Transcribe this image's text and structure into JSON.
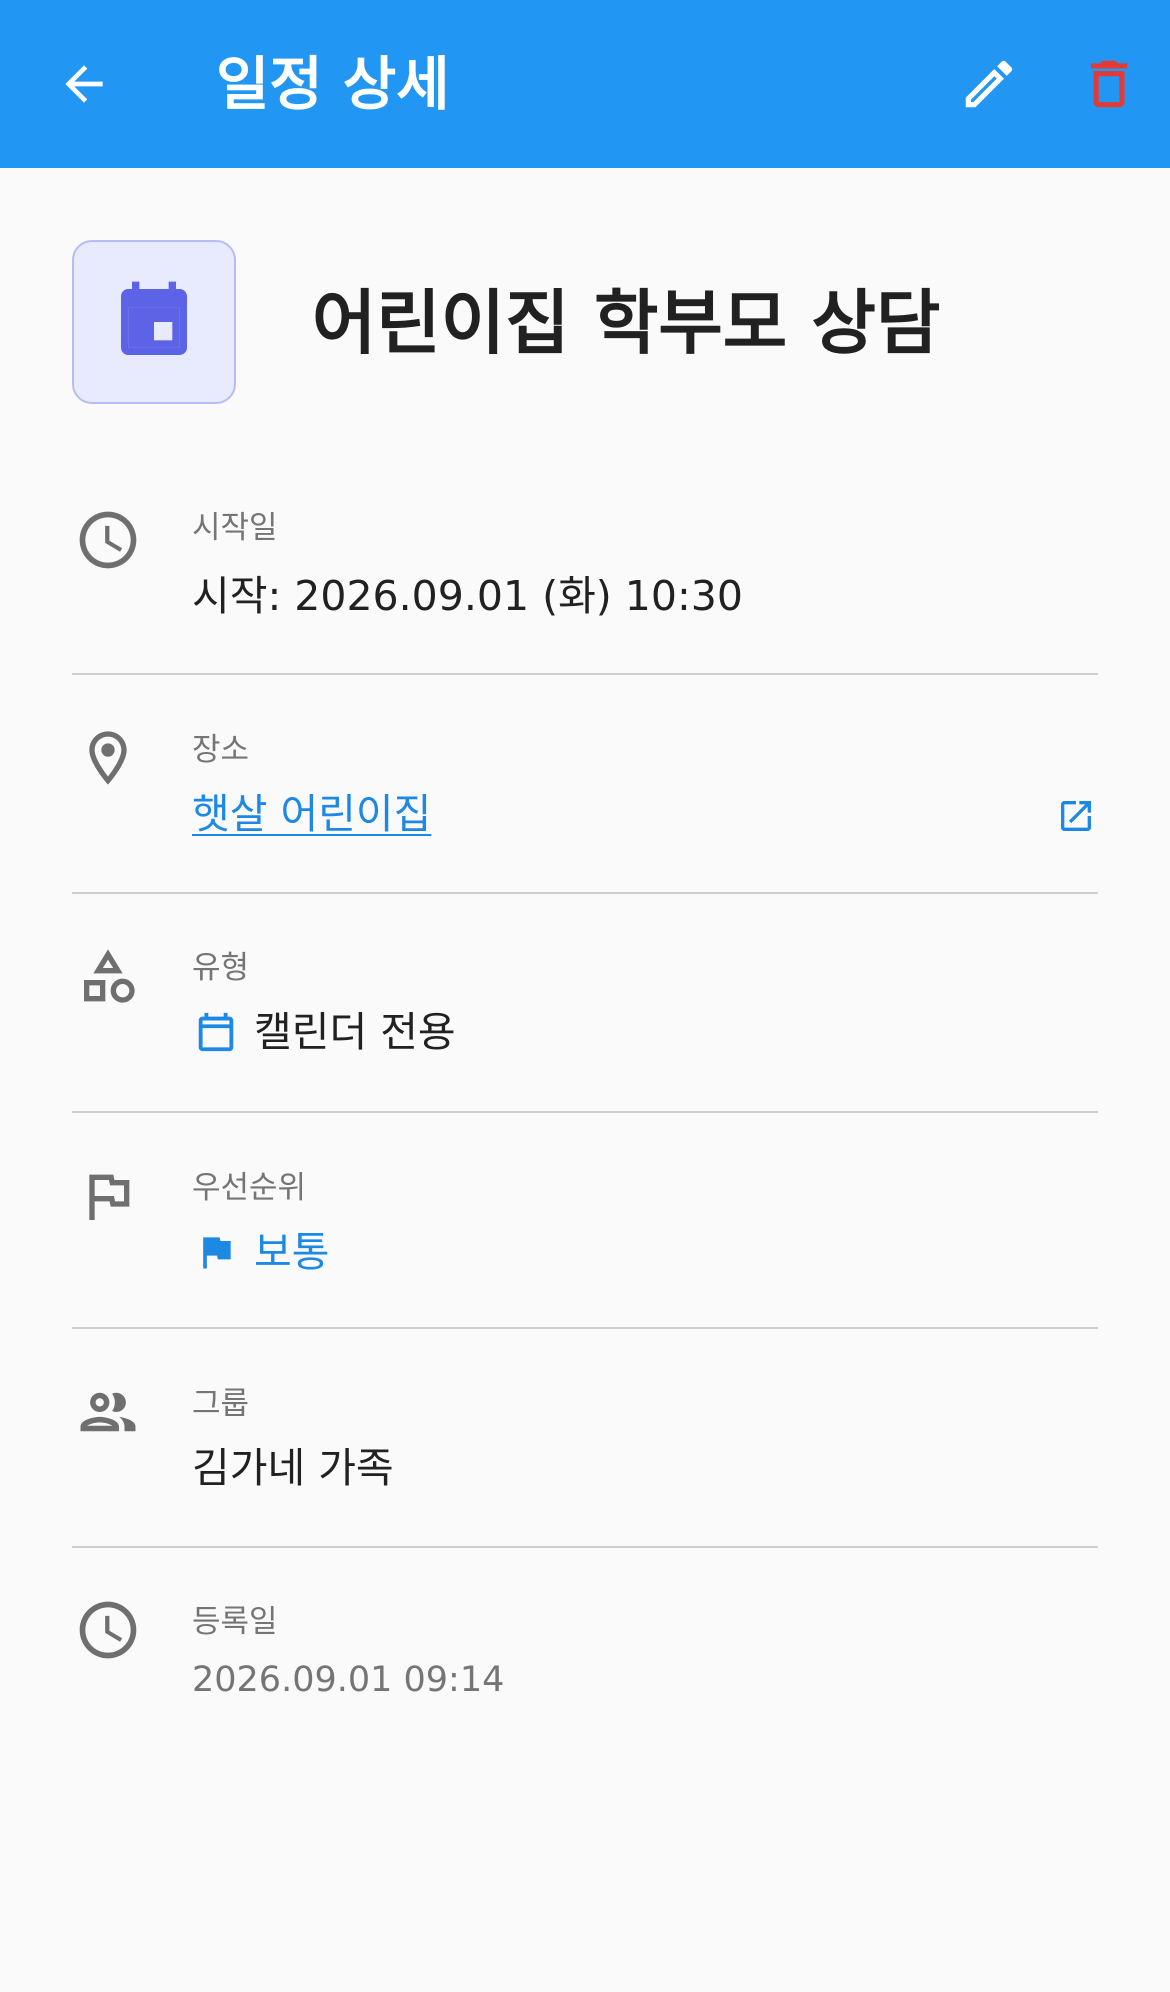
{
  "appbar": {
    "title": "일정 상세",
    "back_icon": "arrow-back-icon",
    "edit_icon": "pencil-icon",
    "delete_icon": "trash-icon"
  },
  "event": {
    "title": "어린이집 학부모 상담",
    "icon": "calendar-icon"
  },
  "details": {
    "start": {
      "label": "시작일",
      "value": "시작: 2026.09.01 (화) 10:30",
      "icon": "clock-icon"
    },
    "location": {
      "label": "장소",
      "value": "햇살 어린이집",
      "icon": "location-pin-icon",
      "action_icon": "open-in-new-icon"
    },
    "type": {
      "label": "유형",
      "value": "캘린더 전용",
      "icon": "category-icon",
      "value_icon": "calendar-icon"
    },
    "priority": {
      "label": "우선순위",
      "value": "보통",
      "icon": "flag-outline-icon",
      "value_icon": "flag-icon"
    },
    "group": {
      "label": "그룹",
      "value": "김가네 가족",
      "icon": "people-icon"
    },
    "registered": {
      "label": "등록일",
      "value": "2026.09.01 09:14",
      "icon": "clock-icon"
    }
  },
  "colors": {
    "appbar": "#2196f3",
    "delete": "#e53935",
    "event_icon": "#5c63e6",
    "link": "#1e88e5",
    "icon_grey": "#6f6f6f"
  }
}
